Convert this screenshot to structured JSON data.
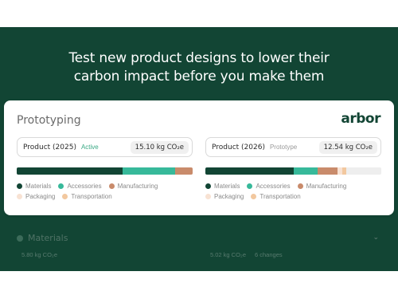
{
  "headline": {
    "line1": "Test new product designs to lower their",
    "line2": "carbon impact before you make them"
  },
  "card": {
    "title": "Prototyping",
    "logo": "arbor"
  },
  "colors": {
    "brand_dark": "#124534",
    "materials": "#124534",
    "accessories": "#37b99a",
    "manufacturing": "#c98b6b",
    "packaging": "#f8e2d3",
    "transportation": "#f2c89f"
  },
  "products": [
    {
      "name": "Product (2025)",
      "status": "Active",
      "status_color": "#3aa985",
      "value": "15.10 kg CO₂e",
      "breakdown": [
        {
          "category": "Materials",
          "fraction": 0.6
        },
        {
          "category": "Accessories",
          "fraction": 0.3
        },
        {
          "category": "Manufacturing",
          "fraction": 0.1
        }
      ]
    },
    {
      "name": "Product (2026)",
      "status": "Prototype",
      "status_color": "#9a9a9a",
      "value": "12.54 kg CO₂e",
      "breakdown": [
        {
          "category": "Materials",
          "fraction": 0.5
        },
        {
          "category": "Accessories",
          "fraction": 0.14
        },
        {
          "category": "Manufacturing",
          "fraction": 0.11
        },
        {
          "category": "Packaging",
          "fraction": 0.03
        },
        {
          "category": "Transportation",
          "fraction": 0.02
        }
      ]
    }
  ],
  "legend": {
    "row1": [
      "Materials",
      "Accessories",
      "Manufacturing"
    ],
    "row2": [
      "Packaging",
      "Transportation"
    ]
  },
  "materials_section": {
    "title": "Materials",
    "left_value": "5.80 kg CO₂e",
    "right_value": "5.02 kg CO₂e",
    "right_changes": "6 changes",
    "chevron_icon": "chevron-down-icon"
  }
}
